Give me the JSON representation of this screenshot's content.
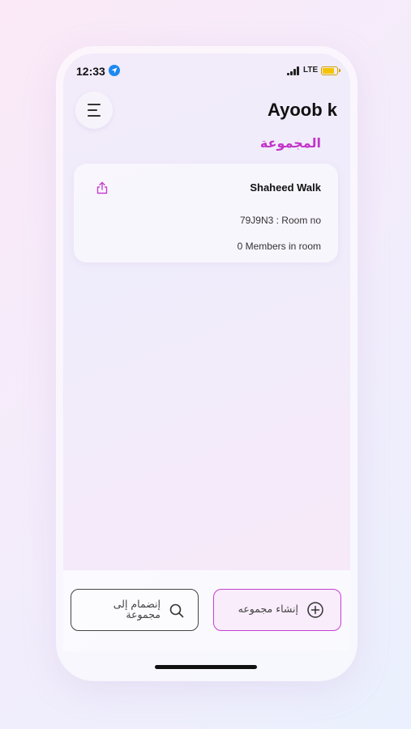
{
  "status_bar": {
    "time": "12:33",
    "network": "LTE"
  },
  "header": {
    "user_name": "Ayoob k",
    "section_title": "المجموعة"
  },
  "rooms": [
    {
      "title": "Shaheed Walk",
      "room_no_label": "Room no",
      "room_no_value": "79J9N3",
      "room_no_text": "79J9N3  : Room no",
      "members_text": "0 Members in room"
    }
  ],
  "actions": {
    "join_label": "إنضمام إلى مجموعة",
    "create_label": "إنشاء مجموعه"
  },
  "colors": {
    "accent": "#c334c9",
    "create_border": "#c640cf",
    "location_blue": "#1e88f0"
  },
  "icons": {
    "menu": "menu-icon",
    "share": "share-icon",
    "search": "search-icon",
    "add": "add-circle-icon"
  }
}
